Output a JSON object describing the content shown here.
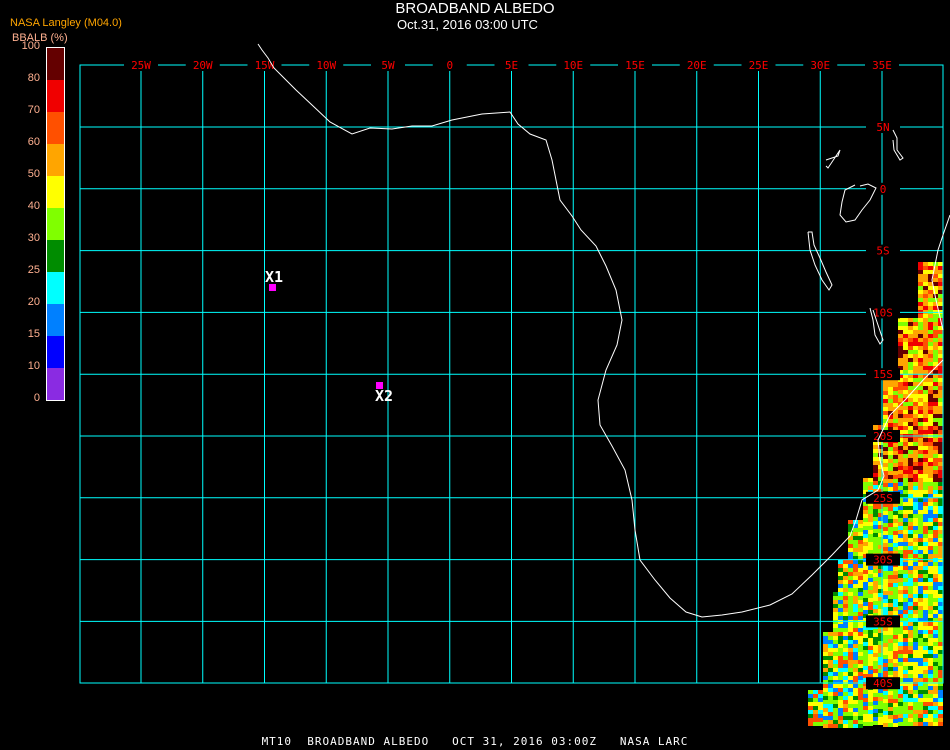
{
  "header": {
    "title": "BROADBAND ALBEDO",
    "subtitle": "Oct.31, 2016 03:00 UTC",
    "source": "NASA Langley (M04.0)"
  },
  "colorbar": {
    "unit_label": "BBALB (%)",
    "ticks": [
      "0",
      "10",
      "15",
      "20",
      "25",
      "30",
      "40",
      "50",
      "60",
      "70",
      "80",
      "100"
    ],
    "colors": [
      "#8a2be2",
      "#0000ff",
      "#0080ff",
      "#00ffff",
      "#008c00",
      "#80ff00",
      "#ffff00",
      "#ffa500",
      "#ff5000",
      "#f00000",
      "#640000"
    ]
  },
  "map": {
    "lon_labels": [
      "25W",
      "20W",
      "15W",
      "10W",
      "5W",
      "0",
      "5E",
      "10E",
      "15E",
      "20E",
      "25E",
      "30E",
      "35E"
    ],
    "lat_labels": [
      "5N",
      "0",
      "5S",
      "10S",
      "15S",
      "20S",
      "25S",
      "30S",
      "35S",
      "40S"
    ],
    "grid_color": "#00ffff",
    "label_color": "#ff0000",
    "coast_color": "#ffffff",
    "markers": [
      {
        "label": "X1",
        "color": "#ff00ff"
      },
      {
        "label": "X2",
        "color": "#ff00ff"
      }
    ]
  },
  "footer": {
    "text": "MT10  BROADBAND ALBEDO   OCT 31, 2016 03:00Z   NASA LARC"
  }
}
